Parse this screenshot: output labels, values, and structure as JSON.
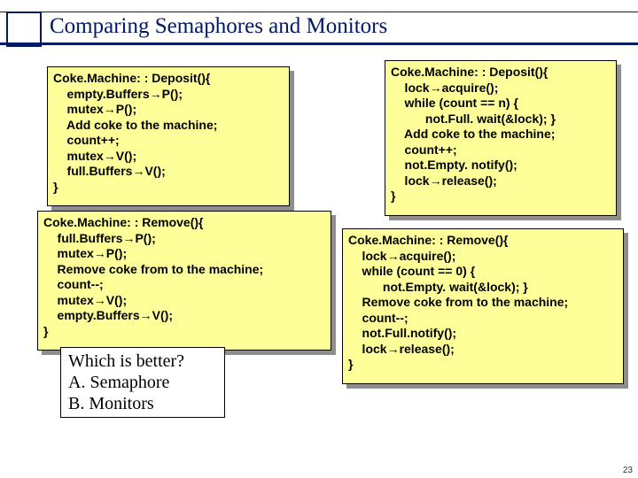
{
  "title": "Comparing Semaphores and Monitors",
  "semaphore_deposit": "Coke.Machine: : Deposit(){\n    empty.Buffers→P();\n    mutex→P();\n    Add coke to the machine;\n    count++;\n    mutex→V();\n    full.Buffers→V();\n}",
  "semaphore_remove": "Coke.Machine: : Remove(){\n    full.Buffers→P();\n    mutex→P();\n    Remove coke from to the machine;\n    count--;\n    mutex→V();\n    empty.Buffers→V();\n}",
  "monitor_deposit": "Coke.Machine: : Deposit(){\n    lock→acquire();\n    while (count == n) {\n          not.Full. wait(&lock); }\n    Add coke to the machine;\n    count++;\n    not.Empty. notify();\n    lock→release();\n}",
  "monitor_remove": "Coke.Machine: : Remove(){\n    lock→acquire();\n    while (count == 0) {\n          not.Empty. wait(&lock); }\n    Remove coke from to the machine;\n    count--;\n    not.Full.notify();\n    lock→release();\n}",
  "question": "Which is better?\nA. Semaphore\nB. Monitors",
  "page_number": "23"
}
